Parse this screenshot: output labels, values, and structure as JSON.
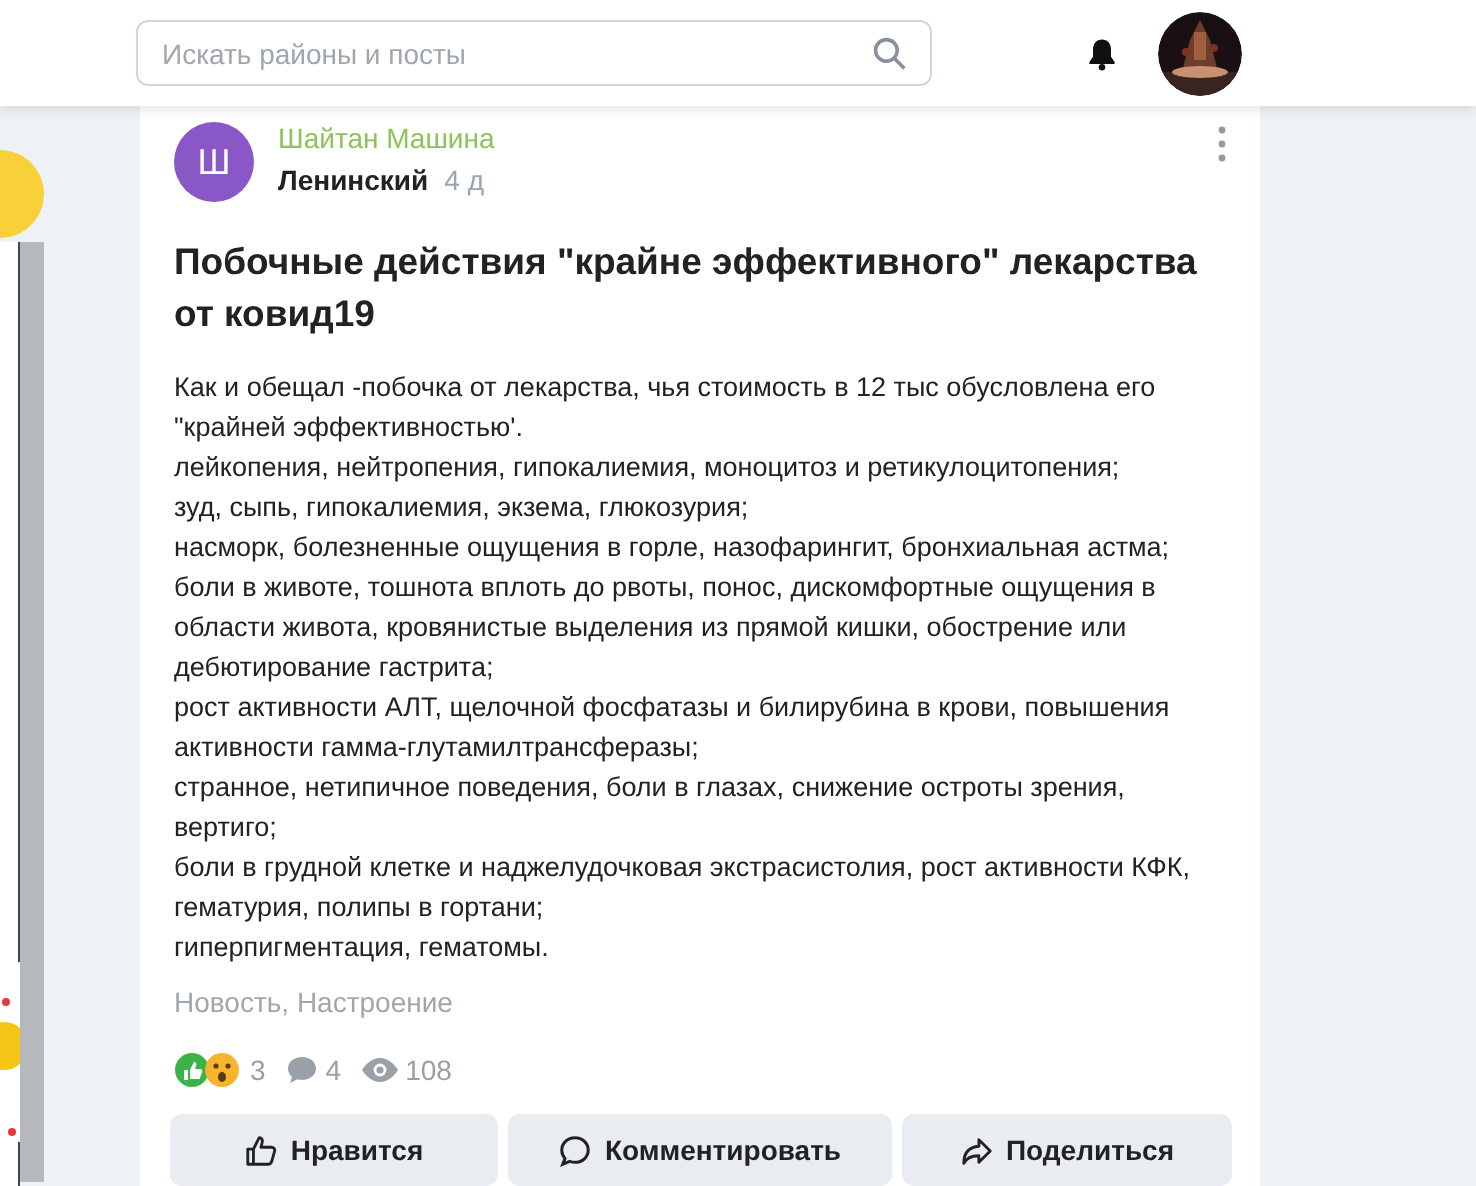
{
  "search": {
    "placeholder": "Искать районы и посты"
  },
  "post": {
    "author": "Шайтан Машина",
    "avatar_letter": "Ш",
    "district": "Ленинский",
    "age": "4 д",
    "title": "Побочные действия \"крайне эффективного\" лекарства от ковид19",
    "paragraphs": [
      "Как и обещал -побочка от лекарства, чья стоимость в 12 тыс обусловлена его \"крайней эффективностью'.",
      "лейкопения, нейтропения, гипокалиемия, моноцитоз и ретикулоцитопения;",
      "зуд, сыпь, гипокалиемия, экзема, глюкозурия;",
      "насморк, болезненные ощущения в горле, назофарингит, бронхиальная астма;",
      "боли в животе, тошнота вплоть до рвоты, понос, дискомфортные ощущения в области живота, кровянистые выделения из прямой кишки, обострение или дебютирование гастрита;",
      "рост активности АЛТ, щелочной фосфатазы и билирубина в крови, повышения активности гамма-глутамилтрансферазы;",
      "странное, нетипичное поведения, боли в глазах, снижение остроты зрения, вертиго;",
      "боли в грудной клетке и наджелудочковая экстрасистолия, рост активности КФК, гематурия, полипы в гортани;",
      "гиперпигментация, гематомы."
    ],
    "tags": "Новость, Настроение",
    "reactions_count": "3",
    "comments_count": "4",
    "views_count": "108",
    "actions": [
      {
        "kind": "like",
        "label": "Нравится"
      },
      {
        "kind": "comment",
        "label": "Комментировать"
      },
      {
        "kind": "share",
        "label": "Поделиться"
      }
    ]
  }
}
